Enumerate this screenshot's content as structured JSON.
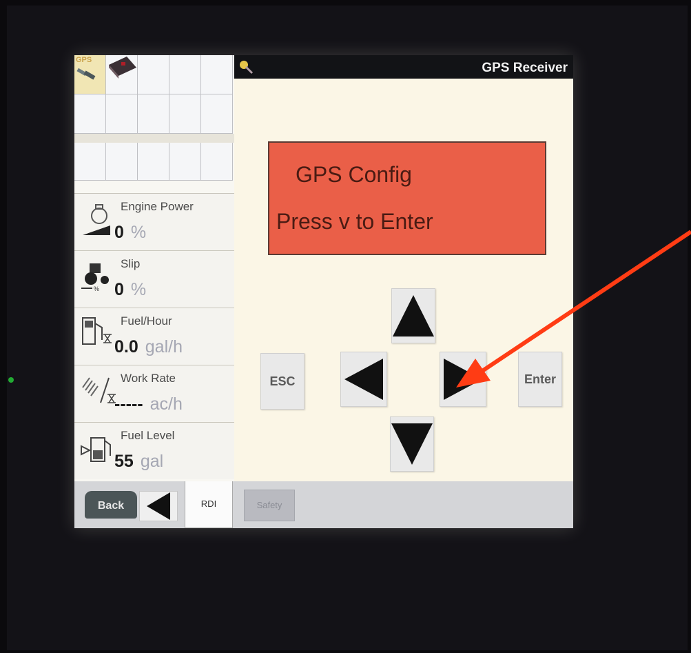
{
  "title_bar": {
    "title": "GPS Receiver",
    "icon": "key-icon"
  },
  "icon_grid": {
    "gps_tag": "GPS"
  },
  "metrics": [
    {
      "label": "Engine Power",
      "value": "0",
      "unit": "%",
      "icon": "engine-icon"
    },
    {
      "label": "Slip",
      "value": "0",
      "unit": "%",
      "icon": "tractor-slip-icon"
    },
    {
      "label": "Fuel/Hour",
      "value": "0.0",
      "unit": "gal/h",
      "icon": "fuel-pump-icon"
    },
    {
      "label": "Work Rate",
      "value": "-----",
      "unit": "ac/h",
      "icon": "work-rate-icon"
    },
    {
      "label": "Fuel Level",
      "value": "55",
      "unit": "gal",
      "icon": "fuel-tank-icon"
    }
  ],
  "message": {
    "line1": "GPS Config",
    "line2": "Press v to Enter"
  },
  "buttons": {
    "esc": "ESC",
    "enter": "Enter"
  },
  "bottom_bar": {
    "back": "Back",
    "rdi": "RDI",
    "safety": "Safety"
  },
  "colors": {
    "message_bg": "#ea5f48",
    "annotation_arrow": "#ff3c14",
    "screen_bg": "#fbf6e6"
  }
}
